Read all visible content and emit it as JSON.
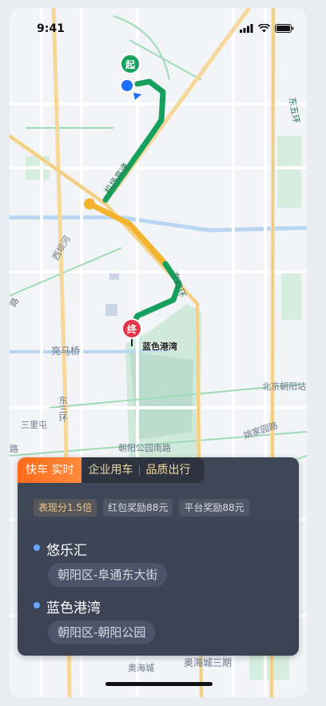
{
  "status_bar": {
    "time": "9:41",
    "icons": [
      "signal-icon",
      "wifi-icon",
      "battery-icon"
    ]
  },
  "map": {
    "start_pin": "起",
    "end_pin": "终",
    "destination_label": "蓝色港湾",
    "road_labels": {
      "airport_expressway": "机场高速",
      "east_4th_ring": "东四环",
      "east_4th_ring_2": "东四环",
      "liangma_bridge": "亮马桥",
      "east_3rd_ring": "东三环",
      "san_li_tun": "三里屯",
      "chaoyang_park_south": "朝阳公园南路",
      "yaojia_road": "姚家园路",
      "beijing_chaoyang": "北京朝阳站",
      "aohai_city": "奥海城",
      "aohai_city_3": "奥海城三期",
      "left_road_1": "路",
      "left_road_2": "路",
      "left_road_3": "路",
      "jichang_side": "西坝河",
      "east_ring_top": "东五环"
    },
    "colors": {
      "route_green": "#16a05d",
      "route_yellow": "#f3b32d",
      "location_blue": "#1f6fff",
      "end_red": "#e2384b"
    }
  },
  "ride_card": {
    "tabs": [
      {
        "label": "快车 实时",
        "active": true
      },
      {
        "label": "企业用车",
        "active": false
      },
      {
        "label": "品质出行",
        "active": false
      }
    ],
    "badges": [
      "表现分1.5倍",
      "红包奖励88元",
      "平台奖励88元"
    ],
    "stops": [
      {
        "name": "悠乐汇",
        "address": "朝阳区-阜通东大街"
      },
      {
        "name": "蓝色港湾",
        "address": "朝阳区-朝阳公园"
      }
    ]
  }
}
